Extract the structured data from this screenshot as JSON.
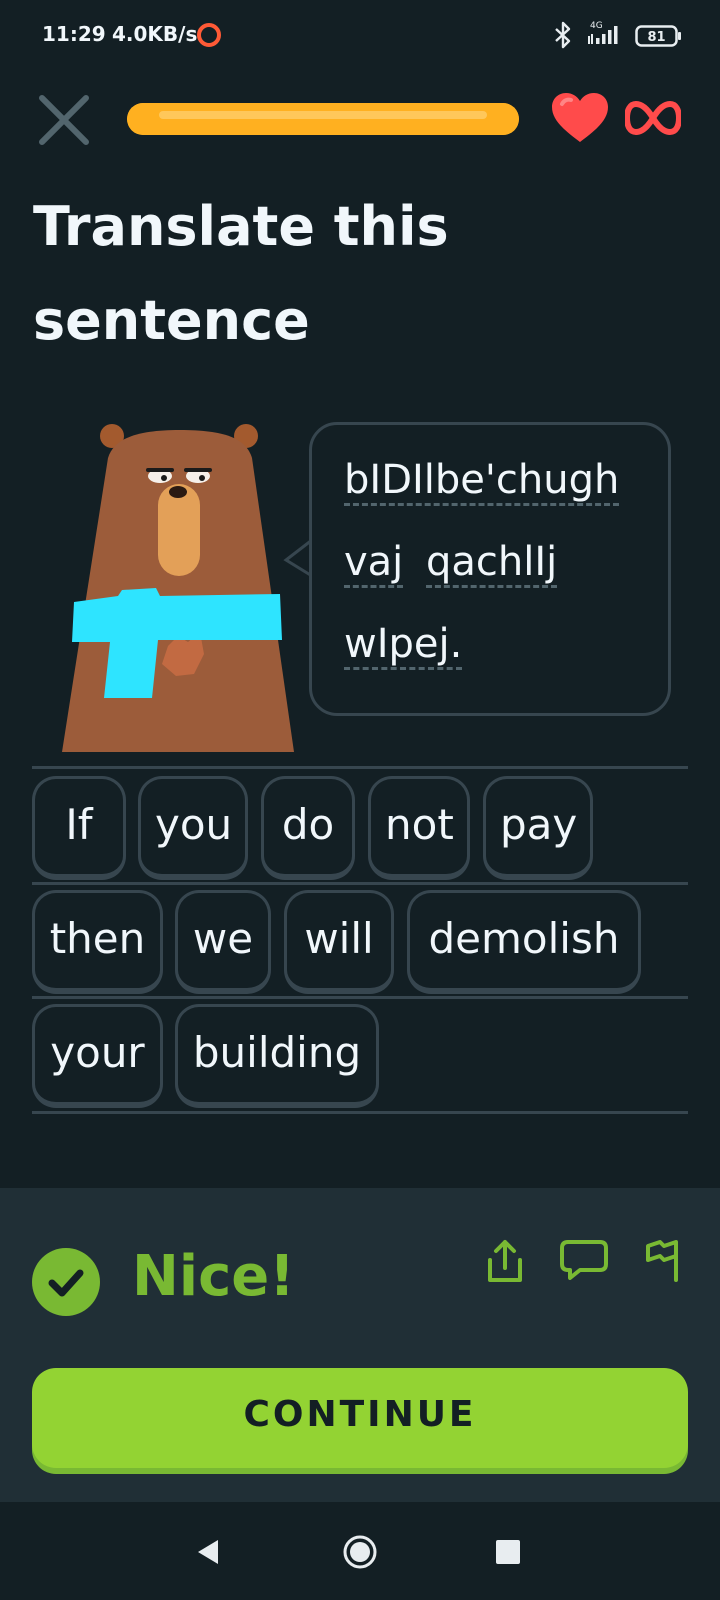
{
  "status_bar": {
    "time": "11:29",
    "speed": "4.0KB/s",
    "network": "4G",
    "battery": "81"
  },
  "header": {
    "progress": 1.0,
    "progress_color": "#ffb020",
    "hearts_icon": "heart-icon",
    "hearts_value_icon": "infinity-icon"
  },
  "prompt": {
    "title_line1": "Translate this",
    "title_line2": "sentence"
  },
  "bubble": {
    "line1": [
      "bIDIlbe'chugh"
    ],
    "line2": [
      "vaj",
      "qachlIj"
    ],
    "line3": [
      "wIpej."
    ]
  },
  "answer": {
    "row1": [
      "If",
      "you",
      "do",
      "not",
      "pay"
    ],
    "row2": [
      "then",
      "we",
      "will",
      "demolish"
    ],
    "row3": [
      "your",
      "building"
    ]
  },
  "feedback": {
    "result": "Nice!",
    "color": "#79b933",
    "continue_label": "CONTINUE"
  }
}
